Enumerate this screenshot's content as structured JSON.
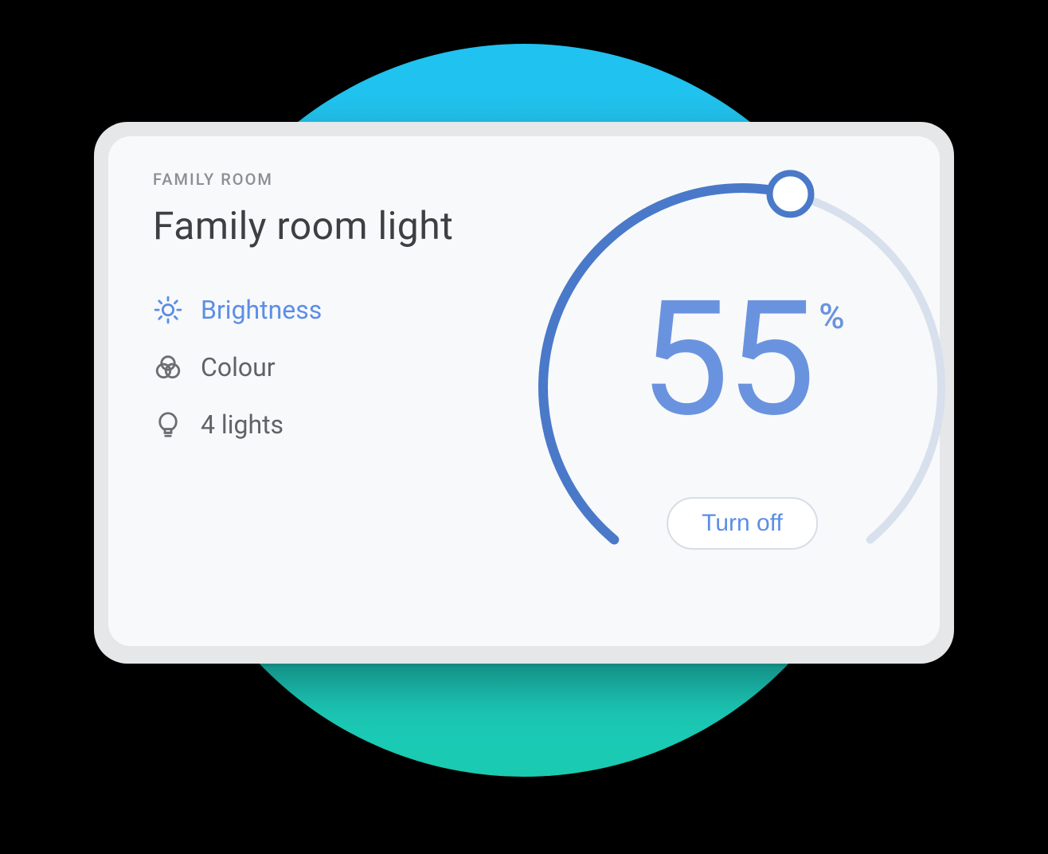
{
  "room": {
    "label": "FAMILY ROOM"
  },
  "device": {
    "title": "Family room light"
  },
  "options": {
    "brightness": {
      "label": "Brightness",
      "active": true
    },
    "colour": {
      "label": "Colour",
      "active": false
    },
    "lights": {
      "label": "4 lights",
      "active": false
    }
  },
  "dial": {
    "value": "55",
    "unit": "%",
    "percent": 55,
    "toggle_label": "Turn off"
  },
  "colors": {
    "accent": "#5c8ee6",
    "arc_active": "#4a79c9",
    "arc_track": "#d7e0ec",
    "text_muted": "#5f6368"
  }
}
